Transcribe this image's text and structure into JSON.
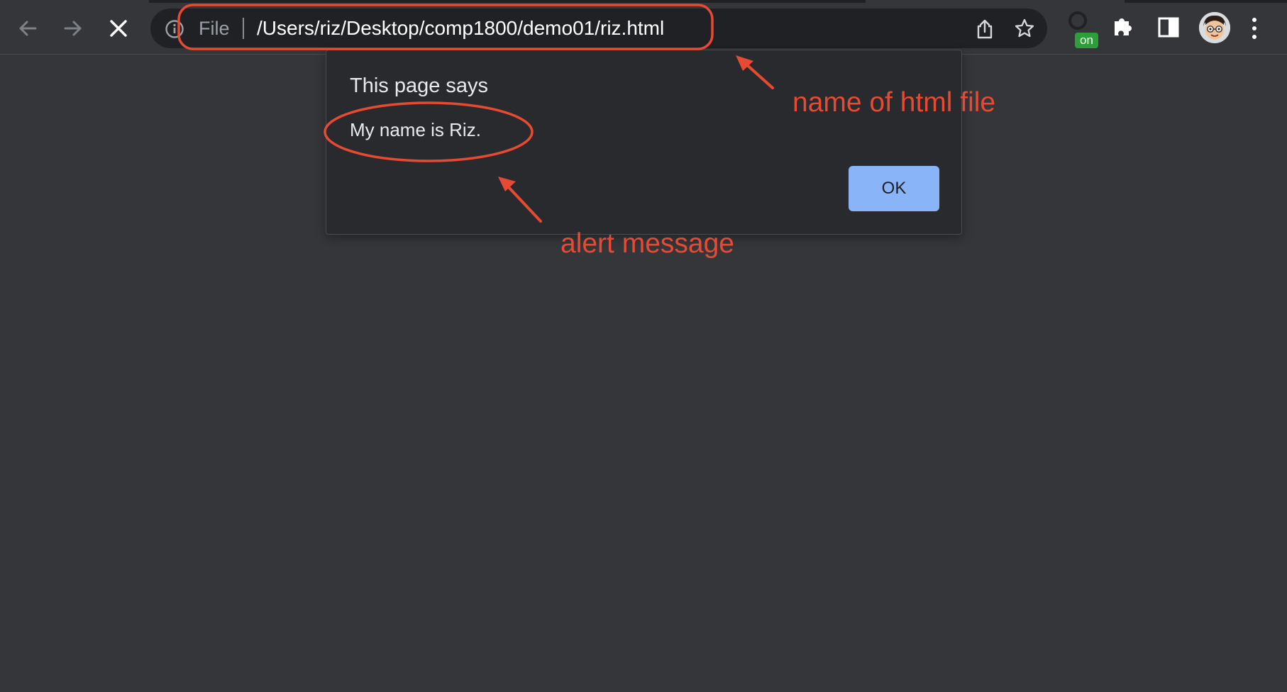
{
  "browser": {
    "address_bar": {
      "scheme_label": "File",
      "url": "/Users/riz/Desktop/comp1800/demo01/riz.html"
    },
    "extension_badge": "on",
    "icons": {
      "back": "back-arrow-icon",
      "forward": "forward-arrow-icon",
      "stop": "close-icon",
      "info": "info-icon",
      "share": "share-icon",
      "bookmark": "star-icon",
      "extension": "extension-status-icon",
      "extensions": "puzzle-icon",
      "side_panel": "side-panel-icon",
      "profile": "avatar",
      "menu": "kebab-menu-icon"
    }
  },
  "dialog": {
    "title": "This page says",
    "message": "My name is Riz.",
    "ok_label": "OK"
  },
  "annotations": {
    "url_label": "name of html file",
    "message_label": "alert message",
    "color": "#e64a33"
  },
  "colors": {
    "page_background": "#35363a",
    "dialog_background": "#292a2d",
    "ok_button": "#8ab4f8"
  }
}
